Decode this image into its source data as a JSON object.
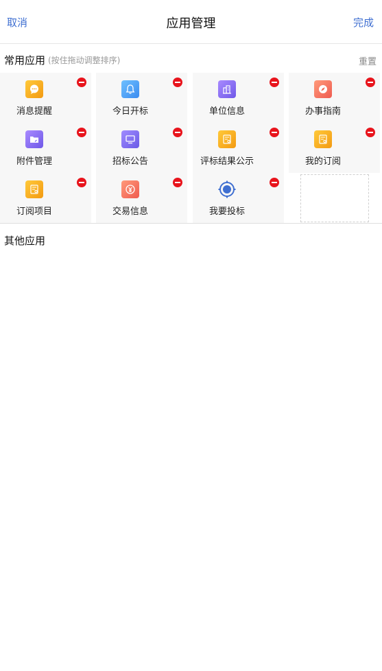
{
  "header": {
    "cancel_label": "取消",
    "title": "应用管理",
    "done_label": "完成",
    "accent_color": "#3f6fd1"
  },
  "common_apps": {
    "title": "常用应用",
    "hint": "(按住拖动调整排序)",
    "reset_label": "重置",
    "items": [
      {
        "label": "消息提醒",
        "icon": "chat-bubble-icon",
        "color": "#f5a623"
      },
      {
        "label": "今日开标",
        "icon": "bell-icon",
        "color": "#5aa8f5"
      },
      {
        "label": "单位信息",
        "icon": "building-icon",
        "color": "#8b6cf0"
      },
      {
        "label": "办事指南",
        "icon": "compass-icon",
        "color": "#f2705a"
      },
      {
        "label": "附件管理",
        "icon": "folder-icon",
        "color": "#8b6cf0"
      },
      {
        "label": "招标公告",
        "icon": "monitor-icon",
        "color": "#7b68ee"
      },
      {
        "label": "评标结果公示",
        "icon": "document-icon",
        "color": "#f5a623"
      },
      {
        "label": "我的订阅",
        "icon": "subscription-icon",
        "color": "#f5a623"
      },
      {
        "label": "订阅项目",
        "icon": "list-document-icon",
        "color": "#f5a623"
      },
      {
        "label": "交易信息",
        "icon": "yuan-coin-icon",
        "color": "#f2705a"
      },
      {
        "label": "我要投标",
        "icon": "target-icon",
        "color": "#3f6fd1"
      }
    ]
  },
  "other_apps": {
    "title": "其他应用"
  }
}
